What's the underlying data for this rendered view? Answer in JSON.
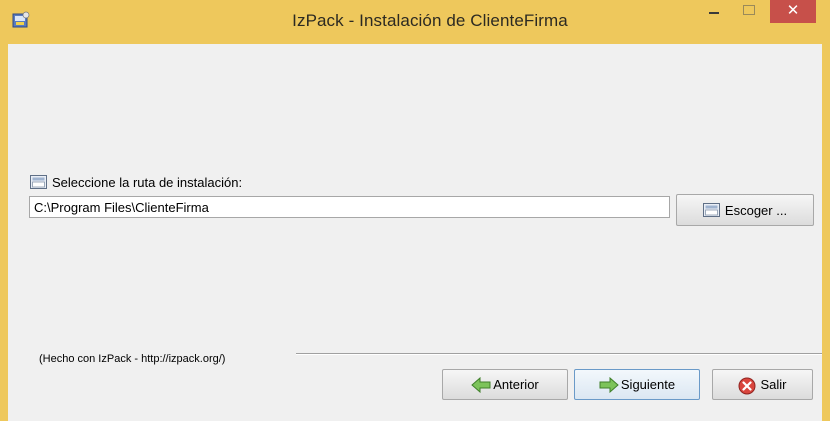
{
  "window": {
    "title": "IzPack - Instalación de  ClienteFirma",
    "accent_color": "#eec85c",
    "close_color": "#c7504a",
    "controls": {
      "minimize_icon": "minimize-icon",
      "maximize_icon": "maximize-icon",
      "close_label": "✕"
    }
  },
  "path_panel": {
    "label": "Seleccione la ruta de instalación:",
    "label_icon": "folder-icon",
    "path_value": "C:\\Program Files\\ClienteFirma",
    "browse_label": "Escoger ...",
    "browse_icon": "folder-icon"
  },
  "footer": {
    "credit": "(Hecho con IzPack - http://izpack.org/)",
    "buttons": {
      "previous": "Anterior",
      "next": "Siguiente",
      "quit": "Salir"
    },
    "icons": {
      "previous": "left-arrow-icon",
      "next": "right-arrow-icon",
      "quit": "stop-icon"
    }
  }
}
